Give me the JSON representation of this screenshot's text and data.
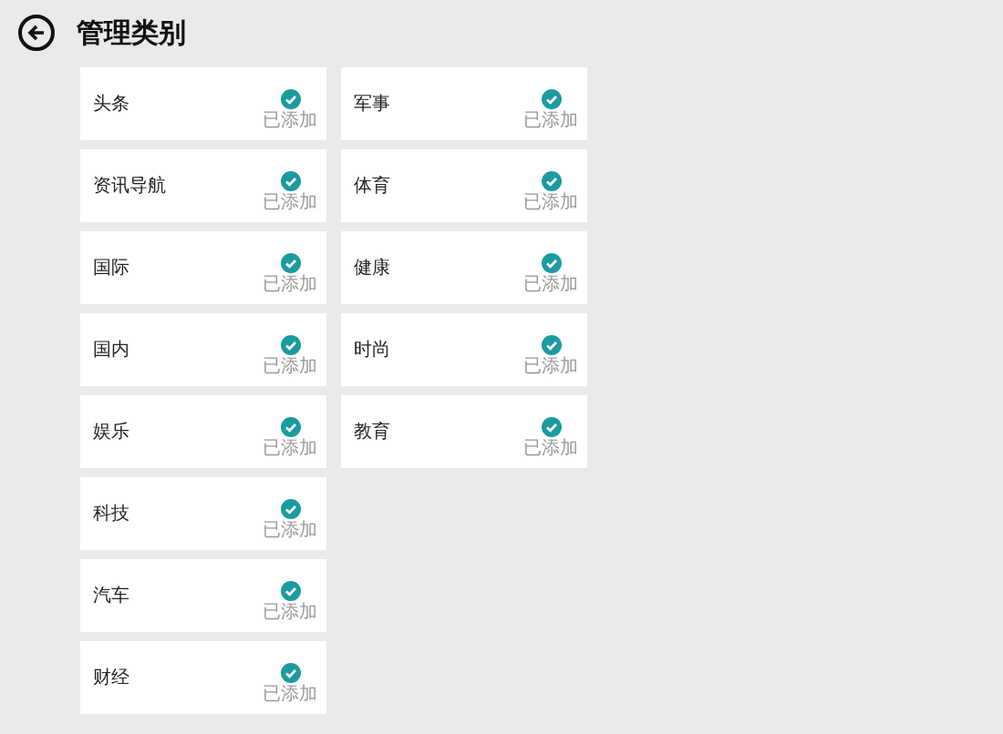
{
  "header": {
    "title": "管理类别"
  },
  "columns": [
    [
      {
        "name": "头条",
        "added": true,
        "status": "已添加"
      },
      {
        "name": "资讯导航",
        "added": true,
        "status": "已添加"
      },
      {
        "name": "国际",
        "added": true,
        "status": "已添加"
      },
      {
        "name": "国内",
        "added": true,
        "status": "已添加"
      },
      {
        "name": "娱乐",
        "added": true,
        "status": "已添加"
      },
      {
        "name": "科技",
        "added": true,
        "status": "已添加"
      },
      {
        "name": "汽车",
        "added": true,
        "status": "已添加"
      },
      {
        "name": "财经",
        "added": true,
        "status": "已添加"
      }
    ],
    [
      {
        "name": "军事",
        "added": true,
        "status": "已添加"
      },
      {
        "name": "体育",
        "added": true,
        "status": "已添加"
      },
      {
        "name": "健康",
        "added": true,
        "status": "已添加"
      },
      {
        "name": "时尚",
        "added": true,
        "status": "已添加"
      },
      {
        "name": "教育",
        "added": true,
        "status": "已添加"
      }
    ]
  ]
}
